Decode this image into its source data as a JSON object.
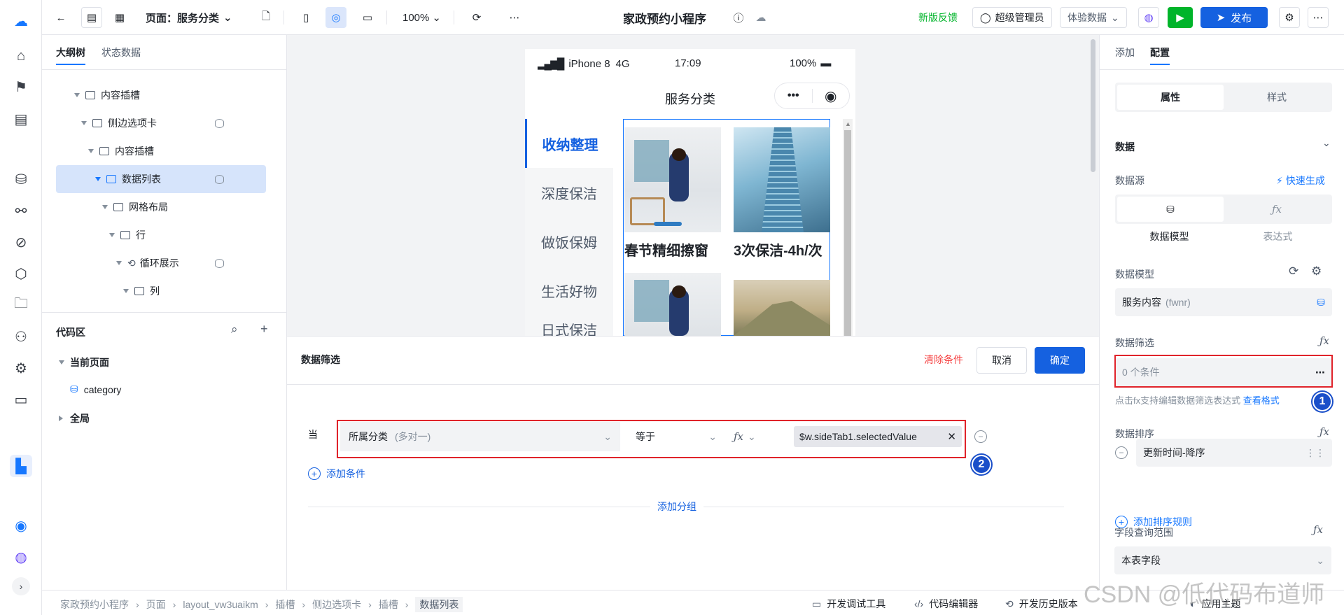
{
  "topbar": {
    "page_label": "页面：服务分类",
    "zoom": "100%",
    "app_title": "家政预约小程序",
    "feedback": "新版反馈",
    "admin": "超级管理员",
    "trial_data": "体验数据",
    "publish": "发布"
  },
  "left": {
    "tabs": [
      "大纲树",
      "状态数据"
    ],
    "tree": [
      {
        "label": "内容插槽"
      },
      {
        "label": "侧边选项卡"
      },
      {
        "label": "内容插槽"
      },
      {
        "label": "数据列表"
      },
      {
        "label": "网格布局"
      },
      {
        "label": "行"
      },
      {
        "label": "循环展示"
      },
      {
        "label": "列"
      }
    ],
    "code_title": "代码区",
    "code_tree": {
      "current": "当前页面",
      "item": "category",
      "global": "全局"
    }
  },
  "phone": {
    "carrier": "iPhone 8",
    "network": "4G",
    "time": "17:09",
    "battery": "100%",
    "title": "服务分类",
    "tabs": [
      "收纳整理",
      "深度保洁",
      "做饭保姆",
      "生活好物",
      "日式保洁"
    ],
    "cards": [
      "春节精细擦窗",
      "3次保洁-4h/次"
    ]
  },
  "filter": {
    "title": "数据筛选",
    "clear": "清除条件",
    "cancel": "取消",
    "ok": "确定",
    "when": "当",
    "field": "所属分类",
    "field_hint": "(多对一)",
    "op": "等于",
    "value": "$w.sideTab1.selectedValue",
    "add_condition": "添加条件",
    "add_group": "添加分组"
  },
  "right": {
    "tabs": [
      "添加",
      "配置"
    ],
    "seg": [
      "属性",
      "样式"
    ],
    "section": "数据",
    "source_label": "数据源",
    "quick_gen": "快速生成",
    "source_opts": [
      "数据模型",
      "表达式"
    ],
    "model_label": "数据模型",
    "model_value": "服务内容",
    "model_code": "(fwnr)",
    "filter_label": "数据筛选",
    "filter_value": "0 个条件",
    "filter_hint": "点击fx支持编辑数据筛选表达式",
    "filter_link": "查看格式",
    "sort_label": "数据排序",
    "sort_value": "更新时间-降序",
    "add_sort": "添加排序规则",
    "scope_label": "字段查询范围",
    "scope_value": "本表字段"
  },
  "bottom": {
    "crumbs": [
      "家政预约小程序",
      "页面",
      "layout_vw3uaikm",
      "插槽",
      "侧边选项卡",
      "插槽",
      "数据列表"
    ],
    "tools": [
      "开发调试工具",
      "代码编辑器",
      "开发历史版本",
      "应用主题"
    ],
    "watermark": "CSDN @低代码布道师"
  },
  "badges": [
    "1",
    "2"
  ],
  "colors": {
    "primary": "#1677ff",
    "highlight": "#e0232a",
    "selected_bg": "#d6e4fb"
  }
}
